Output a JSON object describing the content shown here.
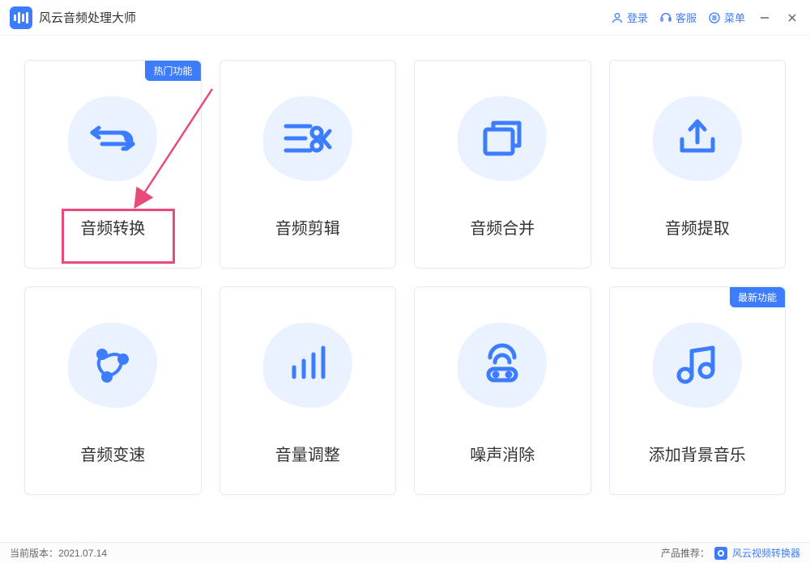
{
  "app": {
    "title": "风云音频处理大师"
  },
  "titlebar": {
    "login": "登录",
    "support": "客服",
    "menu": "菜单"
  },
  "cards": [
    {
      "label": "音频转换",
      "badge": "热门功能",
      "icon": "convert"
    },
    {
      "label": "音频剪辑",
      "badge": null,
      "icon": "cut"
    },
    {
      "label": "音频合并",
      "badge": null,
      "icon": "merge"
    },
    {
      "label": "音频提取",
      "badge": null,
      "icon": "extract"
    },
    {
      "label": "音频变速",
      "badge": null,
      "icon": "speed"
    },
    {
      "label": "音量调整",
      "badge": null,
      "icon": "volume"
    },
    {
      "label": "噪声消除",
      "badge": null,
      "icon": "noise"
    },
    {
      "label": "添加背景音乐",
      "badge": "最新功能",
      "icon": "music"
    }
  ],
  "footer": {
    "version_label": "当前版本：",
    "version": "2021.07.14",
    "recommend_label": "产品推荐：",
    "recommend_product": "风云视频转换器"
  },
  "annotation": {
    "highlight_target": "音频转换"
  }
}
